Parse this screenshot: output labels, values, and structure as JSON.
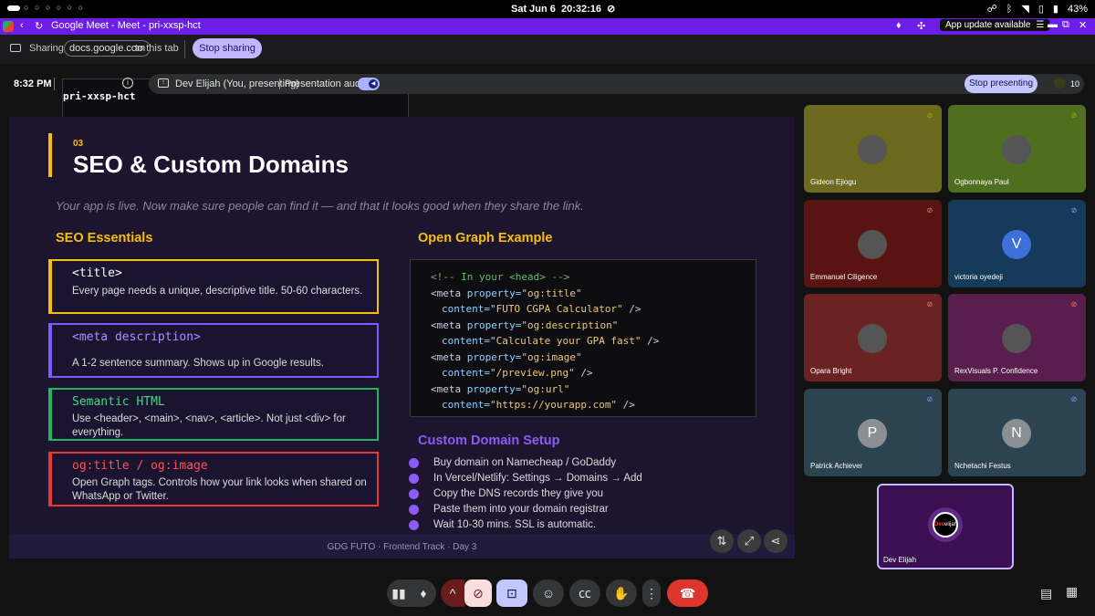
{
  "statusbar": {
    "dots": "○ ○ ○ ○ ○ ○",
    "date": "Sat Jun 6",
    "time": "20:32:16",
    "battery": "43%"
  },
  "browser": {
    "title": "Google Meet - Meet - pri-xxsp-hct",
    "update_label": "App update available"
  },
  "share": {
    "prefix": "Sharing",
    "domain": "docs.google.com",
    "suffix": "to this tab",
    "stop": "Stop sharing"
  },
  "meet": {
    "time": "8:32 PM",
    "code": "pri-xxsp-hct",
    "presenter": "Dev Elijah (You, presenting)",
    "audio_label": "Presentation audio",
    "stop_presenting": "Stop presenting",
    "people_count": "10"
  },
  "slide": {
    "number": "03",
    "title": "SEO & Custom Domains",
    "subtitle": "Your app is live. Now make sure people can find it — and that it looks good when they share the link.",
    "seo_heading": "SEO Essentials",
    "cards": [
      {
        "head": "<title>",
        "body": "Every page needs a unique, descriptive title. 50-60 characters."
      },
      {
        "head": "<meta description>",
        "body": "A 1-2 sentence summary. Shows up in Google results."
      },
      {
        "head": "Semantic HTML",
        "body": "Use <header>, <main>, <nav>, <article>. Not just <div> for everything."
      },
      {
        "head": "og:title / og:image",
        "body": "Open Graph tags. Controls how your link looks when shared on WhatsApp or Twitter."
      }
    ],
    "og_heading": "Open Graph Example",
    "code": {
      "l1": "<!-- In your <head> -->",
      "l2a": "<meta ",
      "l2b": "property=",
      "l2c": "\"og:title\"",
      "l3a": "content=",
      "l3b": "\"FUTO CGPA Calculator\"",
      "l3c": " />",
      "l4a": "<meta ",
      "l4b": "property=",
      "l4c": "\"og:description\"",
      "l5a": "content=",
      "l5b": "\"Calculate your GPA fast\"",
      "l5c": " />",
      "l6a": "<meta ",
      "l6b": "property=",
      "l6c": "\"og:image\"",
      "l7a": "content=",
      "l7b": "\"/preview.png\"",
      "l7c": " />",
      "l8a": "<meta ",
      "l8b": "property=",
      "l8c": "\"og:url\"",
      "l9a": "content=",
      "l9b": "\"https://yourapp.com\"",
      "l9c": " />"
    },
    "domain_heading": "Custom Domain Setup",
    "steps": [
      "Buy domain on Namecheap / GoDaddy",
      "In Vercel/Netlify: Settings → Domains → Add",
      "Copy the DNS records they give you",
      "Paste them into your domain registrar",
      "Wait 10-30 mins. SSL is automatic."
    ],
    "footer": "GDG FUTO  ·  Frontend Track  ·  Day 3"
  },
  "participants": [
    {
      "name": "Gideon Ejiogu",
      "color": "#6b6a1e",
      "initial": "",
      "mic": "dark"
    },
    {
      "name": "Ogbonnaya Paul",
      "color": "#4f6e20",
      "initial": "",
      "mic": "dark"
    },
    {
      "name": "Emmanuel Ciligence",
      "color": "#5a1313",
      "initial": "",
      "mic": "mut"
    },
    {
      "name": "victoria oyedeji",
      "color": "#163a5a",
      "initial": "V",
      "mic": "blue"
    },
    {
      "name": "Opara Bright",
      "color": "#6a2222",
      "initial": "",
      "mic": "mut"
    },
    {
      "name": "RexVisuals P. Confidence",
      "color": "#5a1e4e",
      "initial": "",
      "mic": "mut"
    },
    {
      "name": "Patrick Achiever",
      "color": "#2c4350",
      "initial": "P",
      "mic": "blue"
    },
    {
      "name": "Nchetachi Festus",
      "color": "#2c4350",
      "initial": "N",
      "mic": "blue"
    }
  ],
  "self": {
    "name": "Dev Elijah",
    "logo_a": "Dev",
    "logo_b": "elijah"
  },
  "icons": [
    "search-icon",
    "back-icon",
    "reload-icon",
    "mic-icon",
    "extension-icon",
    "menu-icon",
    "screen-icon",
    "info-icon",
    "present-icon",
    "people-icon",
    "fullscreen-icon",
    "share-icon",
    "swap-icon",
    "chat-icon",
    "apps-icon",
    "end-call-icon",
    "hand-icon",
    "captions-icon",
    "emoji-icon",
    "more-icon",
    "camera-off-icon"
  ]
}
